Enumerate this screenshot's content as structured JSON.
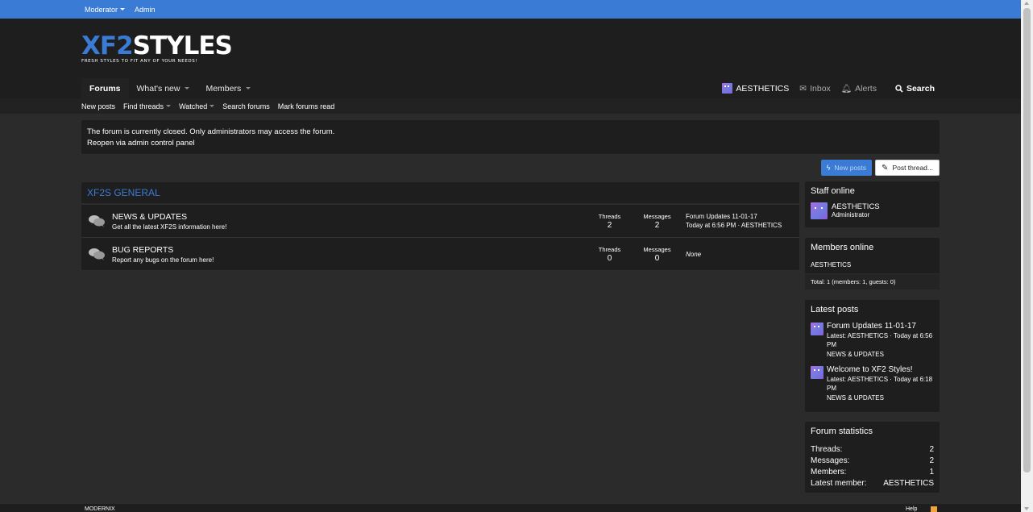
{
  "staffbar": {
    "moderator": "Moderator",
    "admin": "Admin"
  },
  "logo": {
    "part1": "XF2",
    "part2": "STYLES",
    "tagline": "FRESH STYLES TO FIT ANY OF YOUR NEEDS!"
  },
  "nav": {
    "tabs": [
      {
        "label": "Forums"
      },
      {
        "label": "What's new"
      },
      {
        "label": "Members"
      }
    ],
    "user": "AESTHETICS",
    "inbox": "Inbox",
    "alerts": "Alerts",
    "search": "Search"
  },
  "subnav": {
    "new_posts": "New posts",
    "find_threads": "Find threads",
    "watched": "Watched",
    "search_forums": "Search forums",
    "mark_read": "Mark forums read"
  },
  "notice": {
    "line1": "The forum is currently closed. Only administrators may access the forum.",
    "line2": "Reopen via admin control panel"
  },
  "actions": {
    "new_posts": "New posts",
    "post_thread": "Post thread..."
  },
  "category": {
    "title": "XF2S GENERAL"
  },
  "nodes": [
    {
      "title": "NEWS & UPDATES",
      "desc": "Get all the latest XF2S information here!",
      "threads_label": "Threads",
      "threads": "2",
      "messages_label": "Messages",
      "messages": "2",
      "last_title": "Forum Updates 11-01-17",
      "last_meta": "Today at 6:56 PM · AESTHETICS"
    },
    {
      "title": "BUG REPORTS",
      "desc": "Report any bugs on the forum here!",
      "threads_label": "Threads",
      "threads": "0",
      "messages_label": "Messages",
      "messages": "0",
      "last_none": "None"
    }
  ],
  "staff_online": {
    "title": "Staff online",
    "name": "AESTHETICS",
    "role": "Administrator"
  },
  "members_online": {
    "title": "Members online",
    "list": "AESTHETICS",
    "total": "Total: 1 (members: 1, guests: 0)"
  },
  "latest_posts": {
    "title": "Latest posts",
    "items": [
      {
        "title": "Forum Updates 11-01-17",
        "meta": "Latest: AESTHETICS · Today at 6:56 PM",
        "forum": "NEWS & UPDATES"
      },
      {
        "title": "Welcome to XF2 Styles!",
        "meta": "Latest: AESTHETICS · Today at 6:18 PM",
        "forum": "NEWS & UPDATES"
      }
    ]
  },
  "forum_stats": {
    "title": "Forum statistics",
    "rows": [
      {
        "label": "Threads:",
        "value": "2"
      },
      {
        "label": "Messages:",
        "value": "2"
      },
      {
        "label": "Members:",
        "value": "1"
      },
      {
        "label": "Latest member:",
        "value": "AESTHETICS"
      }
    ]
  },
  "footer": {
    "left": "MODERNIX",
    "right": "Help"
  },
  "colors": {
    "accent": "#3a7bd5",
    "background": "#2b2b2b",
    "block": "#1e1e1e"
  }
}
